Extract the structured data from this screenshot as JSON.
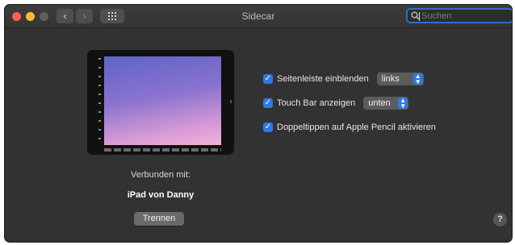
{
  "window": {
    "title": "Sidecar",
    "search_placeholder": "Suchen"
  },
  "toolbar": {
    "back_glyph": "‹",
    "forward_glyph": "›"
  },
  "device": {
    "connected_label": "Verbunden mit:",
    "name": "iPad von Danny",
    "disconnect_label": "Trennen"
  },
  "options": [
    {
      "label": "Seitenleiste einblenden",
      "checked": true,
      "popup_value": "links"
    },
    {
      "label": "Touch Bar anzeigen",
      "checked": true,
      "popup_value": "unten"
    },
    {
      "label": "Doppeltippen auf Apple Pencil aktivieren",
      "checked": true
    }
  ],
  "help_glyph": "?",
  "colors": {
    "accent": "#2f7ae5",
    "window_bg": "#323232",
    "close": "#fe5f57",
    "minimize": "#febb2e"
  }
}
